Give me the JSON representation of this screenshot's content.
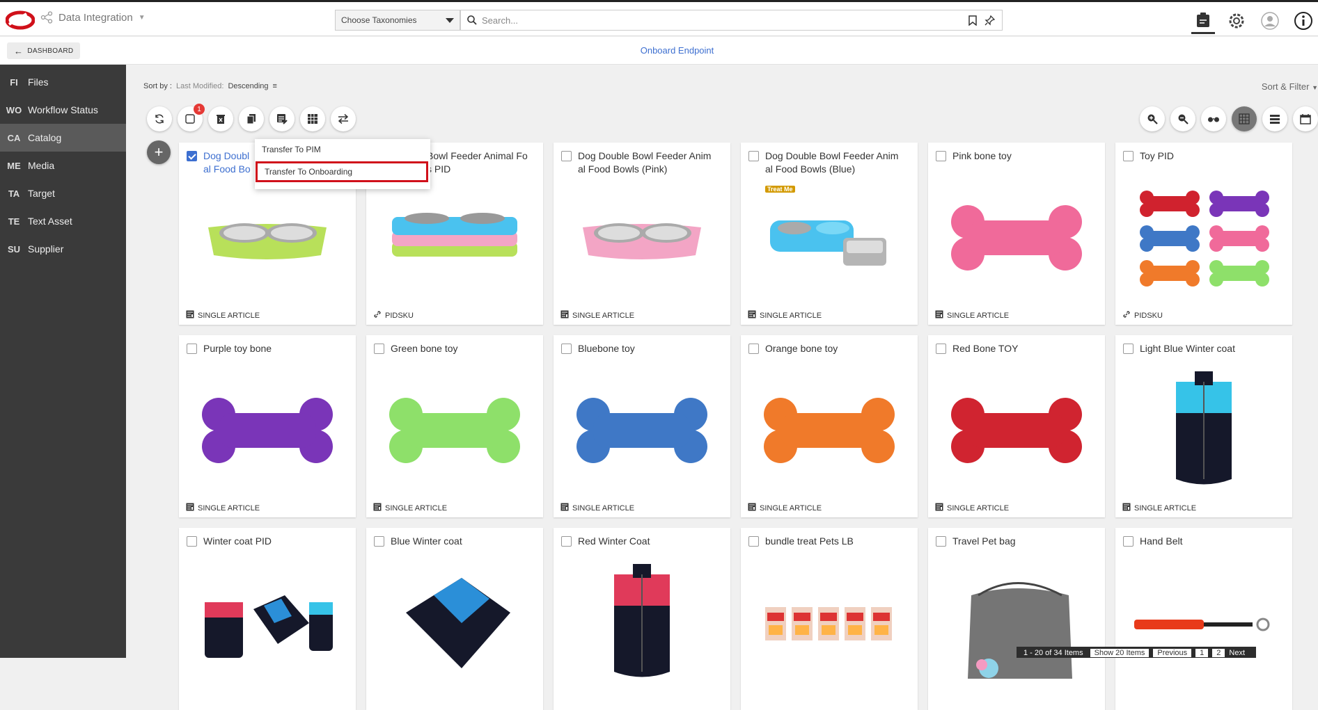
{
  "topbar": {
    "app_name": "Data Integration",
    "taxonomy_select": "Choose Taxonomies",
    "search_placeholder": "Search..."
  },
  "subbar": {
    "dashboard_label": "DASHBOARD",
    "page_title": "Onboard Endpoint"
  },
  "sidebar": {
    "items": [
      {
        "abbr": "FI",
        "label": "Files"
      },
      {
        "abbr": "WO",
        "label": "Workflow Status"
      },
      {
        "abbr": "CA",
        "label": "Catalog"
      },
      {
        "abbr": "ME",
        "label": "Media"
      },
      {
        "abbr": "TA",
        "label": "Target"
      },
      {
        "abbr": "TE",
        "label": "Text Asset"
      },
      {
        "abbr": "SU",
        "label": "Supplier"
      }
    ]
  },
  "sort": {
    "label": "Sort by :",
    "field": "Last Modified:",
    "order": "Descending",
    "filter_label": "Sort & Filter"
  },
  "toolbar": {
    "badge_count": "1"
  },
  "dropdown": {
    "items": [
      "Transfer To PIM",
      "Transfer To Onboarding"
    ]
  },
  "cards": [
    {
      "title": "Dog Double Bowl Feeder Animal Food Bowls",
      "title_visible": "Dog Doubl",
      "title_line2": "al Food Bo",
      "type": "SINGLE ARTICLE",
      "checked": true
    },
    {
      "title": "Bowl Feeder Animal Fo",
      "title_line2": "s PID",
      "type": "PIDSKU",
      "checked": false
    },
    {
      "title": "Dog Double Bowl Feeder Anim",
      "title_line2": "al Food Bowls (Pink)",
      "type": "SINGLE ARTICLE",
      "checked": false
    },
    {
      "title": "Dog Double Bowl Feeder Anim",
      "title_line2": "al Food Bowls (Blue)",
      "type": "SINGLE ARTICLE",
      "checked": false
    },
    {
      "title": "Pink bone toy",
      "title_line2": "",
      "type": "SINGLE ARTICLE",
      "checked": false
    },
    {
      "title": "Toy PID",
      "title_line2": "",
      "type": "PIDSKU",
      "checked": false
    },
    {
      "title": "Purple toy bone",
      "title_line2": "",
      "type": "SINGLE ARTICLE",
      "checked": false
    },
    {
      "title": "Green bone toy",
      "title_line2": "",
      "type": "SINGLE ARTICLE",
      "checked": false
    },
    {
      "title": "Bluebone toy",
      "title_line2": "",
      "type": "SINGLE ARTICLE",
      "checked": false
    },
    {
      "title": "Orange bone toy",
      "title_line2": "",
      "type": "SINGLE ARTICLE",
      "checked": false
    },
    {
      "title": "Red Bone TOY",
      "title_line2": "",
      "type": "SINGLE ARTICLE",
      "checked": false
    },
    {
      "title": "Light Blue Winter coat",
      "title_line2": "",
      "type": "SINGLE ARTICLE",
      "checked": false
    },
    {
      "title": "Winter coat PID",
      "title_line2": "",
      "type": "",
      "checked": false
    },
    {
      "title": "Blue Winter coat",
      "title_line2": "",
      "type": "",
      "checked": false
    },
    {
      "title": "Red Winter Coat",
      "title_line2": "",
      "type": "",
      "checked": false
    },
    {
      "title": "bundle treat Pets LB",
      "title_line2": "",
      "type": "",
      "checked": false
    },
    {
      "title": "Travel Pet bag",
      "title_line2": "",
      "type": "",
      "checked": false
    },
    {
      "title": "Hand Belt",
      "title_line2": "",
      "type": "",
      "checked": false
    }
  ],
  "treat_label": "Treat Me",
  "colors": {
    "accent": "#3d6fd0",
    "highlight": "#d0101a",
    "sidebar": "#3a3a3a",
    "badge": "#e53935"
  },
  "pagination": {
    "range": "1 - 20 of 34 Items",
    "show": "Show 20 Items",
    "previous": "Previous",
    "page1": "1",
    "page2": "2",
    "next": "Next"
  }
}
